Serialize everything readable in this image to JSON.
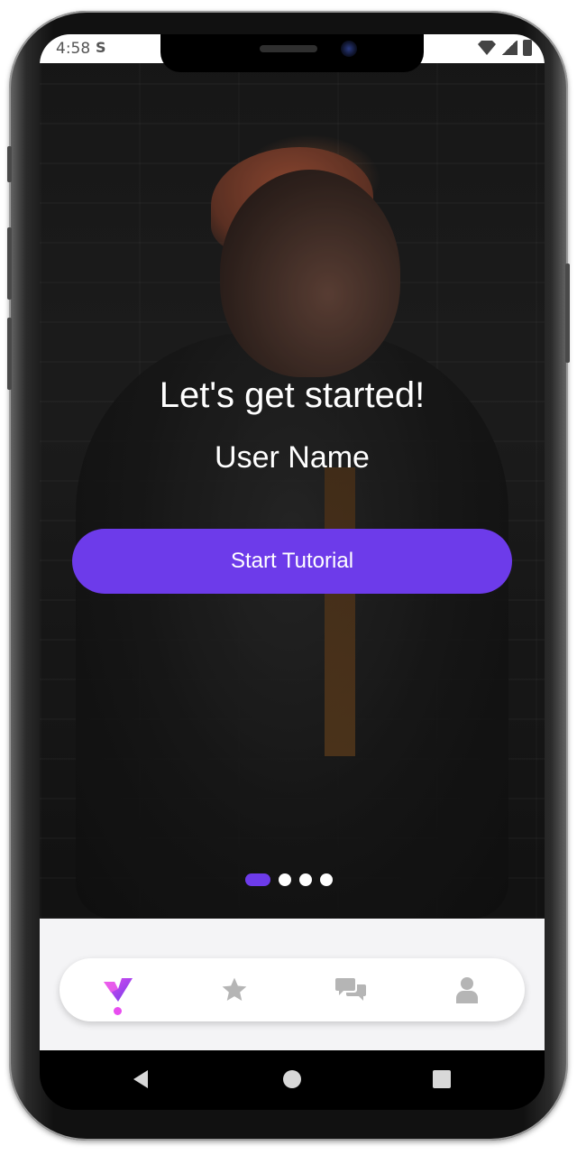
{
  "status_bar": {
    "time": "4:58",
    "app_icon": "S"
  },
  "hero": {
    "title": "Let's get started!",
    "user_name": "User Name"
  },
  "cta": {
    "label": "Start Tutorial"
  },
  "pager": {
    "count": 4,
    "active_index": 0
  },
  "tabbar": {
    "items": [
      {
        "icon": "heart-check-icon",
        "active": true
      },
      {
        "icon": "star-icon",
        "active": false
      },
      {
        "icon": "chat-bubbles-icon",
        "active": false
      },
      {
        "icon": "person-icon",
        "active": false
      }
    ]
  },
  "nav": {
    "items": [
      "back-icon",
      "home-icon",
      "recents-icon"
    ]
  },
  "colors": {
    "accent": "#6d3bea",
    "tab_active_gradient_start": "#e84df0",
    "tab_active_gradient_end": "#6d3bea",
    "tab_inactive": "#b5b5b5"
  }
}
